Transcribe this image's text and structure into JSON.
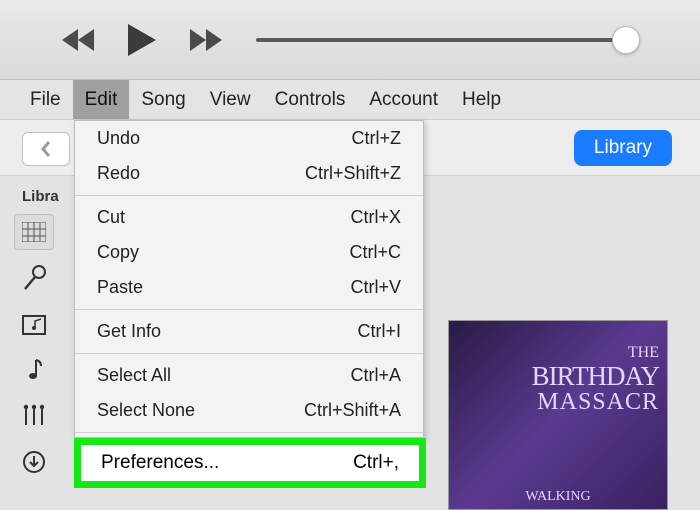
{
  "menubar": {
    "file": "File",
    "edit": "Edit",
    "song": "Song",
    "view": "View",
    "controls": "Controls",
    "account": "Account",
    "help": "Help"
  },
  "toolbar": {
    "library_btn": "Library"
  },
  "sidebar": {
    "heading": "Libra"
  },
  "dropdown": {
    "undo": {
      "label": "Undo",
      "shortcut": "Ctrl+Z"
    },
    "redo": {
      "label": "Redo",
      "shortcut": "Ctrl+Shift+Z"
    },
    "cut": {
      "label": "Cut",
      "shortcut": "Ctrl+X"
    },
    "copy": {
      "label": "Copy",
      "shortcut": "Ctrl+C"
    },
    "paste": {
      "label": "Paste",
      "shortcut": "Ctrl+V"
    },
    "getinfo": {
      "label": "Get Info",
      "shortcut": "Ctrl+I"
    },
    "selectall": {
      "label": "Select All",
      "shortcut": "Ctrl+A"
    },
    "selectnone": {
      "label": "Select None",
      "shortcut": "Ctrl+Shift+A"
    },
    "preferences": {
      "label": "Preferences...",
      "shortcut": "Ctrl+,"
    }
  },
  "album": {
    "line1": "THE",
    "line2": "BIRTHDAY",
    "line3": "MASSACR",
    "bottom": "WALKING"
  },
  "misc": {
    "downloaded": "Downloaded"
  }
}
